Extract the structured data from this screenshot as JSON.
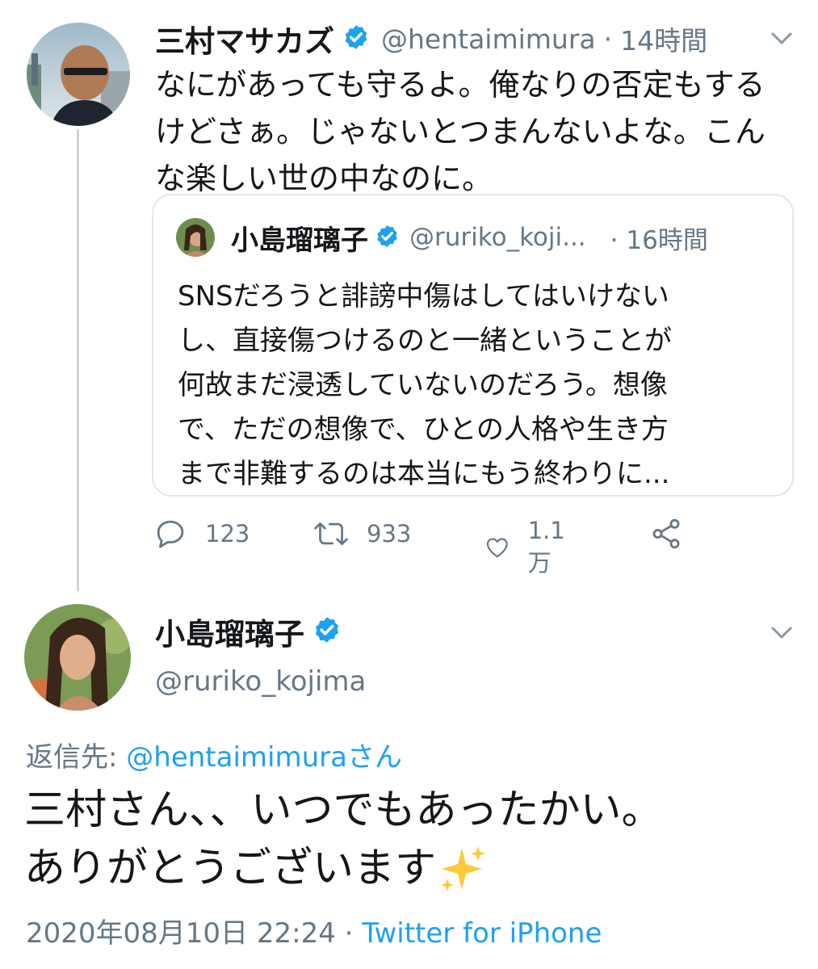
{
  "colors": {
    "text": "#14171a",
    "muted": "#657786",
    "link": "#1da1f2",
    "verified": "#1da1f2",
    "border": "#e1e8ed"
  },
  "parent_tweet": {
    "display_name": "三村マサカズ",
    "handle": "@hentaimimura",
    "separator": "·",
    "time": "14時間",
    "text_lines": [
      "なにがあっても守るよ。俺なりの否定もする",
      "けどさぁ。じゃないとつまんないよな。こん",
      "な楽しい世の中なのに。"
    ],
    "verified_icon": "verified-badge-icon",
    "menu_icon": "chevron-down-icon"
  },
  "quoted_tweet": {
    "display_name": "小島瑠璃子",
    "handle": "@ruriko_koji...",
    "time": "· 16時間",
    "text_lines": [
      "SNSだろうと誹謗中傷はしてはいけない",
      "し、直接傷つけるのと一緒ということが",
      "何故まだ浸透していないのだろう。想像",
      "で、ただの想像で、ひとの人格や生き方",
      "まで非難するのは本当にもう終わりに..."
    ]
  },
  "actions": {
    "reply": {
      "icon": "reply-icon",
      "count": "123"
    },
    "retweet": {
      "icon": "retweet-icon",
      "count": "933"
    },
    "like": {
      "icon": "heart-icon",
      "count": "1.1万"
    },
    "share": {
      "icon": "share-icon"
    }
  },
  "main_tweet": {
    "display_name": "小島瑠璃子",
    "handle": "@ruriko_kojima",
    "reply_to_label": "返信先: ",
    "reply_to_handle": "@hentaimimuraさん",
    "text_lines": [
      "三村さん、、いつでもあったかい。",
      "ありがとうございます"
    ],
    "emoji": "sparkles-icon",
    "timestamp": "2020年08月10日 22:24",
    "separator": " · ",
    "source": "Twitter for iPhone"
  }
}
